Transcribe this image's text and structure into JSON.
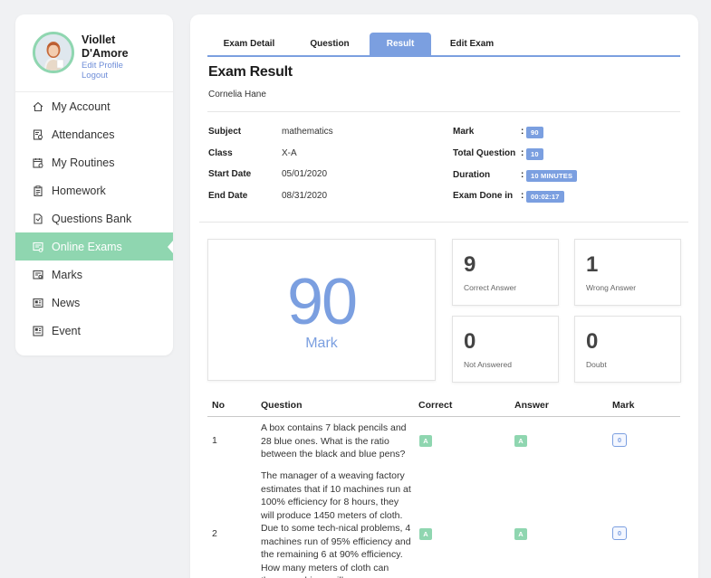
{
  "profile": {
    "name": "Viollet D'Amore",
    "edit_label": "Edit Profile",
    "logout_label": "Logout"
  },
  "menu": [
    {
      "label": "My Account",
      "icon": "home-icon",
      "active": false
    },
    {
      "label": "Attendances",
      "icon": "attendance-icon",
      "active": false
    },
    {
      "label": "My Routines",
      "icon": "calendar-icon",
      "active": false
    },
    {
      "label": "Homework",
      "icon": "clipboard-icon",
      "active": false
    },
    {
      "label": "Questions Bank",
      "icon": "document-icon",
      "active": false
    },
    {
      "label": "Online Exams",
      "icon": "exam-icon",
      "active": true
    },
    {
      "label": "Marks",
      "icon": "marks-icon",
      "active": false
    },
    {
      "label": "News",
      "icon": "news-icon",
      "active": false
    },
    {
      "label": "Event",
      "icon": "event-icon",
      "active": false
    }
  ],
  "tabs": [
    {
      "label": "Exam Detail",
      "active": false
    },
    {
      "label": "Question",
      "active": false
    },
    {
      "label": "Result",
      "active": true
    },
    {
      "label": "Edit Exam",
      "active": false
    }
  ],
  "exam": {
    "title": "Exam Result",
    "student": "Cornelia Hane",
    "subject_label": "Subject",
    "subject": "mathematics",
    "class_label": "Class",
    "class": "X-A",
    "start_label": "Start Date",
    "start": "05/01/2020",
    "end_label": "End Date",
    "end": "08/31/2020",
    "mark_label": "Mark",
    "mark": "90",
    "total_label": "Total Question",
    "total": "10",
    "duration_label": "Duration",
    "duration": "10 MINUTES",
    "done_label": "Exam Done in",
    "done": "00:02:17",
    "colon": ":"
  },
  "score": {
    "mark_value": "90",
    "mark_label": "Mark",
    "correct_value": "9",
    "correct_label": "Correct Answer",
    "wrong_value": "1",
    "wrong_label": "Wrong Answer",
    "not_answered_value": "0",
    "not_answered_label": "Not Answered",
    "doubt_value": "0",
    "doubt_label": "Doubt"
  },
  "table": {
    "headers": {
      "no": "No",
      "question": "Question",
      "correct": "Correct",
      "answer": "Answer",
      "mark": "Mark"
    },
    "rows": [
      {
        "no": "1",
        "question": "A box contains 7 black pencils and 28 blue ones. What is the ratio between the black and blue pens?",
        "correct": "A",
        "answer": "A",
        "mark": "0"
      },
      {
        "no": "2",
        "question": "The manager of a weaving factory estimates that if 10 machines run at 100% efficiency for 8 hours, they will produce 1450 meters of cloth. Due to some tech-nical problems, 4 machines run of 95% efficiency and the remaining 6 at 90% efficiency. How many meters of cloth can these machines will",
        "correct": "A",
        "answer": "A",
        "mark": "0"
      }
    ]
  },
  "colors": {
    "accent_green": "#8fd6b0",
    "accent_blue": "#7b9fe0"
  }
}
